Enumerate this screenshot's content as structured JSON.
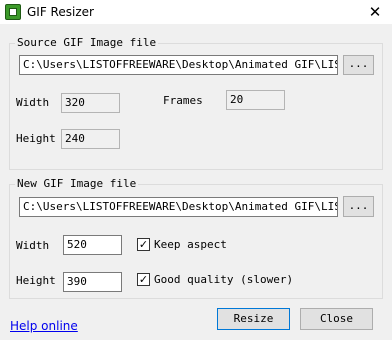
{
  "window": {
    "title": "GIF Resizer",
    "close_glyph": "✕"
  },
  "source": {
    "group_label": "Source GIF Image file",
    "path": "C:\\Users\\LISTOFFREEWARE\\Desktop\\Animated GIF\\LISTOFF",
    "browse_label": "...",
    "width_label": "Width",
    "width_value": "320",
    "height_label": "Height",
    "height_value": "240",
    "frames_label": "Frames",
    "frames_value": "20"
  },
  "target": {
    "group_label": "New GIF Image file",
    "path": "C:\\Users\\LISTOFFREEWARE\\Desktop\\Animated GIF\\LISTOFF",
    "browse_label": "...",
    "width_label": "Width",
    "width_value": "520",
    "height_label": "Height",
    "height_value": "390",
    "keep_aspect_label": "Keep aspect",
    "keep_aspect_checked": true,
    "good_quality_label": "Good quality (slower)",
    "good_quality_checked": true,
    "check_glyph": "✓"
  },
  "footer": {
    "help_link": "Help online",
    "resize_label": "Resize",
    "close_label": "Close"
  }
}
